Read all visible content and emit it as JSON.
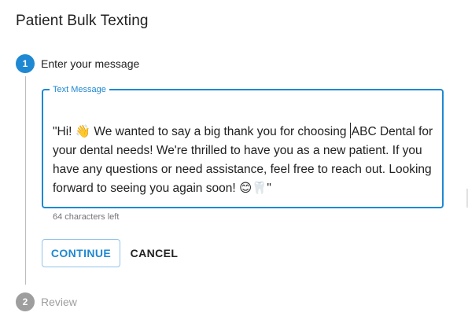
{
  "page": {
    "title": "Patient Bulk Texting"
  },
  "stepper": {
    "steps": [
      {
        "number": "1",
        "label": "Enter your message",
        "state": "active"
      },
      {
        "number": "2",
        "label": "Review",
        "state": "inactive"
      }
    ]
  },
  "message": {
    "field_label": "Text Message",
    "text_before_cursor": "\"Hi! 👋 We wanted to say a big thank you for choosing ",
    "text_after_cursor": "ABC Dental for your dental needs! We're thrilled to have you as a new patient. If you have any questions or need assistance, feel free to reach out. Looking forward to seeing you again soon! 😊🦷\"",
    "helper_text": "64 characters left"
  },
  "actions": {
    "continue_label": "CONTINUE",
    "cancel_label": "CANCEL"
  },
  "colors": {
    "accent": "#1e88d2",
    "inactive": "#9e9e9e",
    "text": "#212121",
    "helper": "#757575"
  }
}
